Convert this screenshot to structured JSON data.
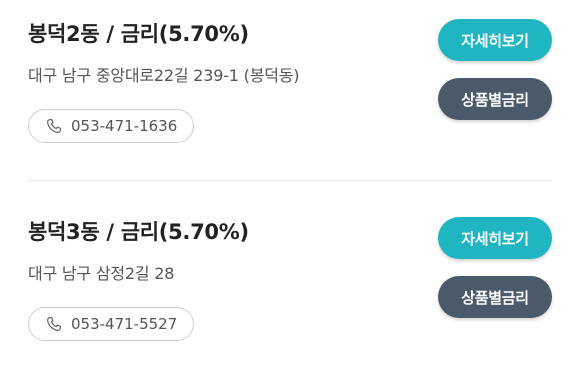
{
  "colors": {
    "detail_button": "#1fb6c1",
    "rates_button": "#4a5a6a",
    "title_text": "#222222",
    "sub_text": "#555555",
    "pill_border": "#cfcfcf"
  },
  "branches": [
    {
      "title": "봉덕2동 / 금리(5.70%)",
      "address": "대구 남구 중앙대로22길 239-1 (봉덕동)",
      "phone": "053-471-1636",
      "phone_icon": "phone-icon",
      "detail_label": "자세히보기",
      "rates_label": "상품별금리"
    },
    {
      "title": "봉덕3동 / 금리(5.70%)",
      "address": "대구 남구 삼정2길 28",
      "phone": "053-471-5527",
      "phone_icon": "phone-icon",
      "detail_label": "자세히보기",
      "rates_label": "상품별금리"
    }
  ]
}
